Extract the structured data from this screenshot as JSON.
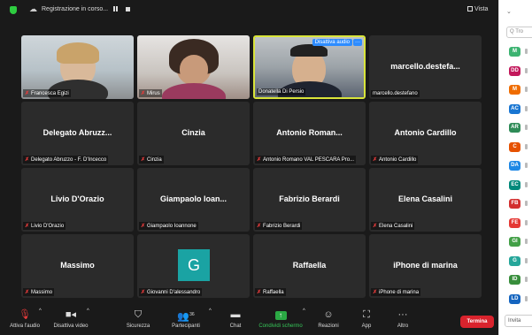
{
  "topbar": {
    "recording_label": "Registrazione in corso...",
    "view_label": "Vista"
  },
  "tiles": [
    {
      "name_label": "Francesca Egizi",
      "big_name": ""
    },
    {
      "name_label": "Mirus",
      "big_name": ""
    },
    {
      "name_label": "Donatella Di Persio",
      "big_name": "",
      "overlay_button": "Disattiva audio",
      "overlay_more": "···"
    },
    {
      "name_label": "marcello.destefano",
      "big_name": "marcello.destefa..."
    },
    {
      "name_label": "Delegato Abruzzo - F. D'Incecco",
      "big_name": "Delegato Abruzz..."
    },
    {
      "name_label": "Cinzia",
      "big_name": "Cinzia"
    },
    {
      "name_label": "Antonio Romano VAL PESCARA Pro...",
      "big_name": "Antonio Roman..."
    },
    {
      "name_label": "Antonio Cardillo",
      "big_name": "Antonio Cardillo"
    },
    {
      "name_label": "Livio D'Orazio",
      "big_name": "Livio D'Orazio"
    },
    {
      "name_label": "Giampaolo Ioannone",
      "big_name": "Giampaolo Ioan..."
    },
    {
      "name_label": "Fabrizio Berardi",
      "big_name": "Fabrizio Berardi"
    },
    {
      "name_label": "Elena Casalini",
      "big_name": "Elena Casalini"
    },
    {
      "name_label": "Massimo",
      "big_name": "Massimo"
    },
    {
      "name_label": "Giovanni D'alessandro",
      "big_name": "",
      "avatar_letter": "G"
    },
    {
      "name_label": "Raffaella",
      "big_name": "Raffaella"
    },
    {
      "name_label": "iPhone di marina",
      "big_name": "iPhone di marina"
    }
  ],
  "toolbar": {
    "unmute": "Attiva l'audio",
    "video": "Disattiva video",
    "security": "Sicurezza",
    "participants": "Partecipanti",
    "participants_count": "36",
    "chat": "Chat",
    "share": "Condividi schermo",
    "reactions": "Reazioni",
    "apps": "App",
    "more": "Altro",
    "end": "Termina"
  },
  "panel": {
    "search_placeholder": "Q Tro",
    "invite_label": "Invita",
    "avatars": [
      {
        "initials": "M",
        "color": "#3cb371"
      },
      {
        "initials": "DD",
        "color": "#c2185b"
      },
      {
        "initials": "M",
        "color": "#ef6c00"
      },
      {
        "initials": "AC",
        "color": "#1976d2"
      },
      {
        "initials": "AR",
        "color": "#2e8b57"
      },
      {
        "initials": "C",
        "color": "#e65100"
      },
      {
        "initials": "DA",
        "color": "#1e88e5"
      },
      {
        "initials": "EC",
        "color": "#00897b"
      },
      {
        "initials": "FB",
        "color": "#d32f2f"
      },
      {
        "initials": "FE",
        "color": "#e53935"
      },
      {
        "initials": "GI",
        "color": "#43a047"
      },
      {
        "initials": "G",
        "color": "#26a69a"
      },
      {
        "initials": "ID",
        "color": "#388e3c"
      },
      {
        "initials": "LD",
        "color": "#1565c0"
      }
    ]
  },
  "colors": {
    "active_speaker_border": "#d9e43a",
    "end_button": "#d9232d",
    "share_green": "#2ba944",
    "muted_red": "#e63b3b",
    "accent_blue": "#2d8cff"
  }
}
